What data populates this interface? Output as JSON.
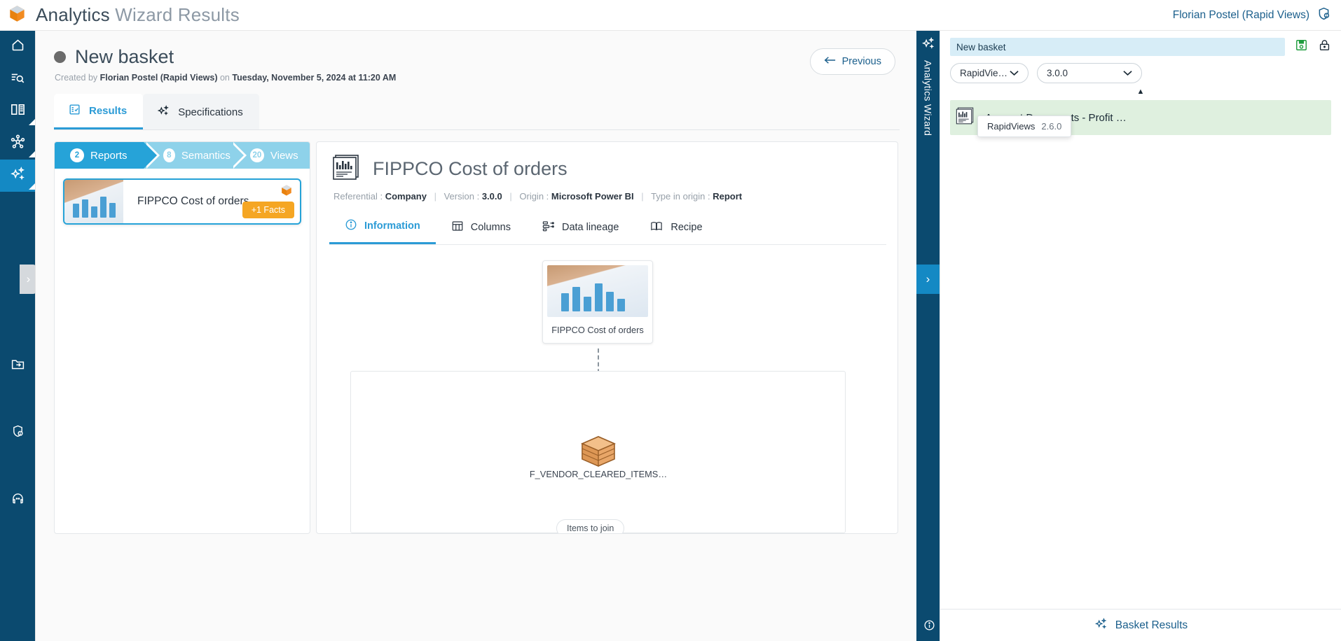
{
  "app": {
    "brand_primary": "Analytics",
    "brand_secondary": "Wizard Results",
    "logo_icon": "cube-icon",
    "user": "Florian Postel (Rapid Views)",
    "user_icon": "shield-user-icon"
  },
  "rail": {
    "items": [
      {
        "icon": "home-icon",
        "name": "home"
      },
      {
        "icon": "search-list-icon",
        "name": "catalog-search"
      },
      {
        "icon": "book-icon",
        "name": "glossary"
      },
      {
        "icon": "network-icon",
        "name": "lineage"
      },
      {
        "icon": "sparkle-icon",
        "name": "analytics-wizard"
      },
      {
        "icon": "folder-import-icon",
        "name": "import"
      },
      {
        "icon": "shield-lock-icon",
        "name": "security"
      },
      {
        "icon": "support-icon",
        "name": "support"
      }
    ],
    "expand_handle": "›"
  },
  "page": {
    "title": "New basket",
    "status_dot_color": "#6b6b6b",
    "created_prefix": "Created by",
    "created_by": "Florian Postel (Rapid Views)",
    "created_on_prefix": "on",
    "created_on": "Tuesday, November 5, 2024 at 11:20 AM",
    "previous_label": "Previous",
    "previous_icon": "arrow-left-icon"
  },
  "tabs": [
    {
      "label": "Results",
      "icon": "results-list-icon",
      "active": true
    },
    {
      "label": "Specifications",
      "icon": "sparkle-icon",
      "active": false
    }
  ],
  "steps": [
    {
      "count": "2",
      "label": "Reports",
      "active": true
    },
    {
      "count": "8",
      "label": "Semantics",
      "active": false
    },
    {
      "count": "20",
      "label": "Views",
      "active": false
    }
  ],
  "report_card": {
    "name": "FIPPCO Cost of orders",
    "facts_badge": "+1 Facts",
    "badge_color": "#f5a623",
    "corner_icon": "cube-icon",
    "thumbnail_icon": "report-thumbnail"
  },
  "detail": {
    "icon": "report-chart-icon",
    "title": "FIPPCO Cost of orders",
    "meta": {
      "referential_label": "Referential :",
      "referential_value": "Company",
      "version_label": "Version :",
      "version_value": "3.0.0",
      "origin_label": "Origin :",
      "origin_value": "Microsoft Power BI",
      "type_label": "Type in origin :",
      "type_value": "Report",
      "separator": "|"
    },
    "tabs": [
      {
        "label": "Information",
        "icon": "info-icon",
        "active": true
      },
      {
        "label": "Columns",
        "icon": "table-icon",
        "active": false
      },
      {
        "label": "Data lineage",
        "icon": "lineage-icon",
        "active": false
      },
      {
        "label": "Recipe",
        "icon": "book-open-icon",
        "active": false
      }
    ],
    "lineage": {
      "node_label": "FIPPCO Cost of orders",
      "cube_label": "F_VENDOR_CLEARED_ITEMS…",
      "cube_icon": "cube-icon",
      "join_chip": "Items to join"
    }
  },
  "wizard_strip": {
    "icon": "sparkle-icon",
    "label": "Analytics Wizard",
    "handle": "›"
  },
  "wizard": {
    "basket_value": "New basket",
    "basket_placeholder": "New basket",
    "save_icon": "save-icon",
    "lock_icon": "lock-icon",
    "referential_select": "RapidVie…",
    "version_select": "3.0.0",
    "caret_icon": "caret-up-icon",
    "items": [
      {
        "label": "Account Documents - Profit …",
        "icon": "report-chart-icon"
      }
    ],
    "tooltip": {
      "name": "RapidViews",
      "version": "2.6.0"
    },
    "footer_label": "Basket Results",
    "footer_icon": "sparkle-icon",
    "info_icon": "info-icon"
  },
  "colors": {
    "navy": "#0b4a6f",
    "accent_blue": "#1489c4",
    "step_active": "#26a3d8",
    "step_inactive": "#8ed2ea",
    "orange": "#f5a623",
    "link": "#1b5f8c"
  }
}
